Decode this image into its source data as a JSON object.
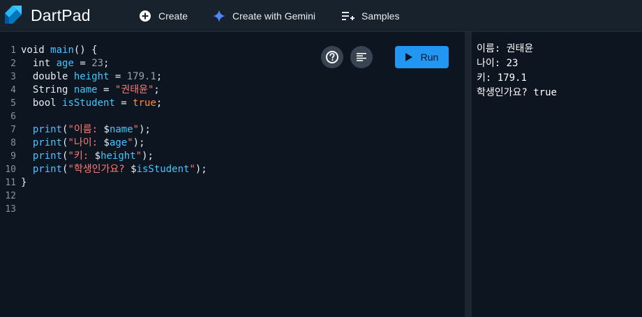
{
  "app": {
    "title": "DartPad"
  },
  "nav": {
    "create": "Create",
    "gemini": "Create with Gemini",
    "samples": "Samples"
  },
  "toolbar": {
    "run": "Run"
  },
  "code": {
    "line_numbers": [
      "1",
      "2",
      "3",
      "4",
      "5",
      "6",
      "7",
      "8",
      "9",
      "10",
      "11",
      "12",
      "13"
    ],
    "tokens": {
      "l1_void": "void",
      "l1_main": "main",
      "l1_rest": "() {",
      "l2_type": "int",
      "l2_var": "age",
      "l2_eq": " = ",
      "l2_val": "23",
      "l2_end": ";",
      "l3_type": "double",
      "l3_var": "height",
      "l3_eq": " = ",
      "l3_val": "179.1",
      "l3_end": ";",
      "l4_type": "String",
      "l4_var": "name",
      "l4_eq": " = ",
      "l4_val": "\"권태윤\"",
      "l4_end": ";",
      "l5_type": "bool",
      "l5_var": "isStudent",
      "l5_eq": " = ",
      "l5_val": "true",
      "l5_end": ";",
      "l7_fn": "print",
      "l7_open": "(",
      "l7_str": "\"이름: ",
      "l7_d": "$",
      "l7_v": "name",
      "l7_q": "\"",
      "l7_close": ");",
      "l8_fn": "print",
      "l8_open": "(",
      "l8_str": "\"나이: ",
      "l8_d": "$",
      "l8_v": "age",
      "l8_q": "\"",
      "l8_close": ");",
      "l9_fn": "print",
      "l9_open": "(",
      "l9_str": "\"키: ",
      "l9_d": "$",
      "l9_v": "height",
      "l9_q": "\"",
      "l9_close": ");",
      "l10_fn": "print",
      "l10_open": "(",
      "l10_str": "\"학생인가요? ",
      "l10_d": "$",
      "l10_v": "isStudent",
      "l10_q": "\"",
      "l10_close": ");",
      "l11": "}"
    }
  },
  "console": {
    "lines": [
      "이름: 권태윤",
      "나이: 23",
      "키: 179.1",
      "학생인가요? true"
    ]
  },
  "icons": {
    "logo": "dart-logo-icon",
    "create": "add-circle-icon",
    "gemini": "gemini-sparkle-icon",
    "samples": "playlist-add-icon",
    "help": "help-circle-icon",
    "format": "format-align-icon",
    "run": "play-icon"
  },
  "colors": {
    "accent": "#2196f3",
    "string": "#ff7b72",
    "identifier": "#3ec8ff"
  }
}
